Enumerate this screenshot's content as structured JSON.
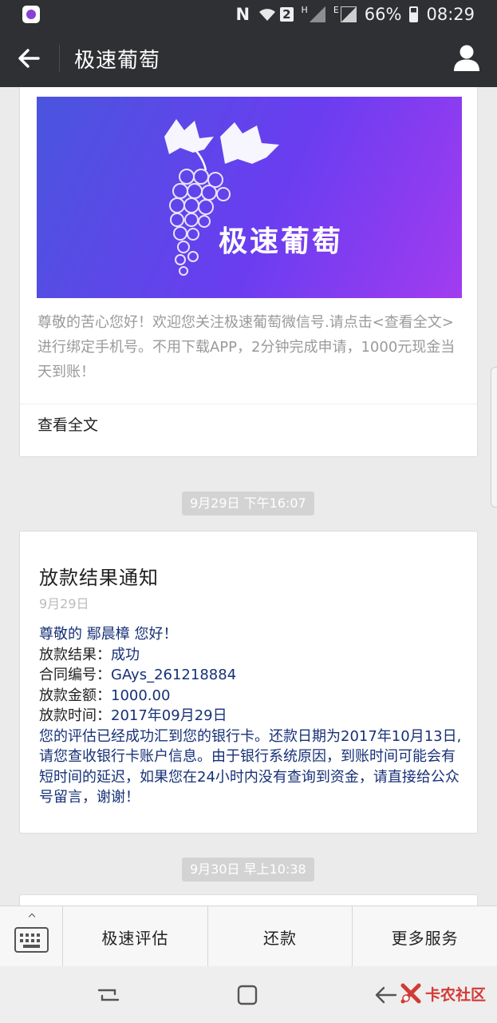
{
  "status_bar": {
    "network_tag": "2",
    "h_tag": "H",
    "e_tag": "E",
    "battery": "66%",
    "time": "08:29"
  },
  "header": {
    "title": "极速葡萄"
  },
  "article": {
    "banner_text": "极速葡萄",
    "digest": "尊敬的苦心您好！欢迎您关注极速葡萄微信号.请点击<查看全文>进行绑定手机号。不用下载APP，2分钟完成申请，1000元现金当天到账！",
    "read_more": "查看全文"
  },
  "timestamps": [
    "9月29日 下午16:07",
    "9月30日 早上10:38"
  ],
  "notice": {
    "title": "放款结果通知",
    "date": "9月29日",
    "greeting": "尊敬的 鄢晨樟 您好！",
    "result_label": "放款结果：",
    "result": "成功",
    "contract_label": "合同编号：",
    "contract": "GAys_261218884",
    "amount_label": "放款金额：",
    "amount": "1000.00",
    "time_label": "放款时间：",
    "time": "2017年09月29日",
    "body": "您的评估已经成功汇到您的银行卡。还款日期为2017年10月13日,请您查收银行卡账户信息。由于银行系统原因，到账时间可能会有短时间的延迟，如果您在24小时内没有查询到资金，请直接给公众号留言，谢谢！"
  },
  "menu": {
    "items": [
      "极速评估",
      "还款",
      "更多服务"
    ]
  },
  "watermark": "卡农社区"
}
